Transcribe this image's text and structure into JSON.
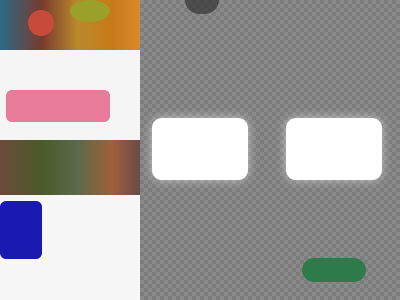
{
  "thumbnails": [
    {
      "name": "thumbnail-1"
    },
    {
      "name": "thumbnail-2"
    },
    {
      "name": "thumbnail-3"
    },
    {
      "name": "thumbnail-4"
    }
  ],
  "cards": [
    {
      "name": "placeholder-card-left"
    },
    {
      "name": "placeholder-card-right"
    }
  ],
  "colors": {
    "workspace_light": "#8a8a8a",
    "workspace_dark": "#7c7c7c",
    "panel_background": "#e9e9e9",
    "card_background": "#ffffff",
    "confirm_button": "#2f7a4a",
    "thumb_pink": "#e87a9a",
    "thumb_blue": "#1a1ab0"
  }
}
